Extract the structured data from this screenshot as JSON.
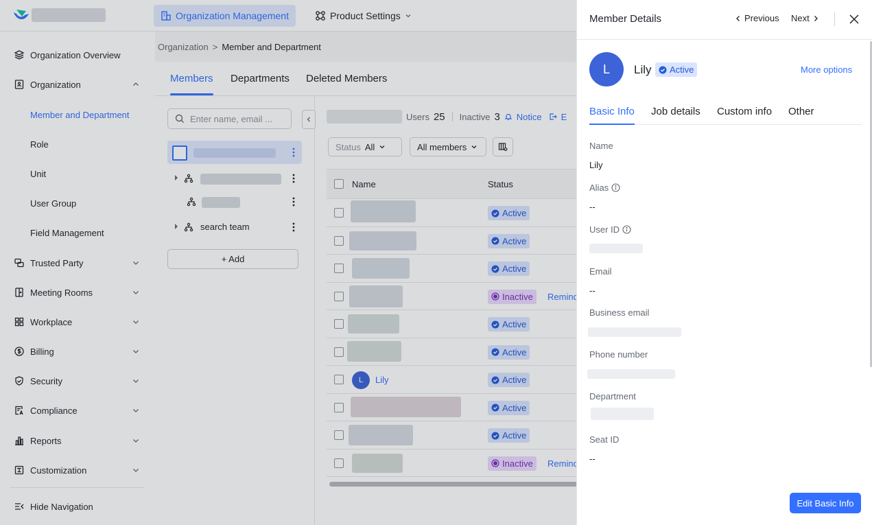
{
  "topbar": {
    "tabs": [
      {
        "label": "Organization Management",
        "icon": "org-chart-icon",
        "active": true
      },
      {
        "label": "Product Settings",
        "icon": "product-settings-icon",
        "active": false
      }
    ]
  },
  "sidebar": {
    "items": [
      {
        "label": "Organization Overview",
        "icon": "layers-icon"
      },
      {
        "label": "Organization",
        "icon": "org-badge-icon",
        "expanded": true
      },
      {
        "label": "Member and Department",
        "selected": true
      },
      {
        "label": "Role"
      },
      {
        "label": "Unit"
      },
      {
        "label": "User Group"
      },
      {
        "label": "Field Management"
      },
      {
        "label": "Trusted Party",
        "icon": "trusted-party-icon"
      },
      {
        "label": "Meeting Rooms",
        "icon": "door-icon"
      },
      {
        "label": "Workplace",
        "icon": "grid-icon"
      },
      {
        "label": "Billing",
        "icon": "dollar-icon"
      },
      {
        "label": "Security",
        "icon": "shield-icon"
      },
      {
        "label": "Compliance",
        "icon": "compliance-icon"
      },
      {
        "label": "Reports",
        "icon": "bar-chart-icon"
      },
      {
        "label": "Customization",
        "icon": "customization-icon"
      }
    ],
    "hide_nav": "Hide Navigation"
  },
  "breadcrumb": {
    "root": "Organization",
    "separator": ">",
    "current": "Member and Department"
  },
  "subtabs": [
    "Members",
    "Departments",
    "Deleted Members"
  ],
  "dept_panel": {
    "search_placeholder": "Enter name, email ...",
    "tree_items": [
      "search team"
    ],
    "add_label": "+ Add"
  },
  "stats": {
    "users_label": "Users",
    "users_count": "25",
    "inactive_label": "Inactive",
    "inactive_count": "3",
    "notice": "Notice",
    "export_partial": "E"
  },
  "filters": {
    "status_label": "Status",
    "status_value": "All",
    "members_value": "All members"
  },
  "table": {
    "headers": {
      "name": "Name",
      "status": "Status"
    },
    "rows": [
      {
        "name": "",
        "status": "Active"
      },
      {
        "name": "",
        "status": "Active"
      },
      {
        "name": "",
        "status": "Active"
      },
      {
        "name": "",
        "status": "Inactive",
        "remind": "Remind"
      },
      {
        "name": "",
        "status": "Active"
      },
      {
        "name": "",
        "status": "Active"
      },
      {
        "name": "Lily",
        "avatar": "L",
        "status": "Active"
      },
      {
        "name": "",
        "status": "Active"
      },
      {
        "name": "",
        "status": "Active"
      },
      {
        "name": "",
        "status": "Inactive",
        "remind": "Remind"
      }
    ]
  },
  "drawer": {
    "title": "Member Details",
    "previous": "Previous",
    "next": "Next",
    "profile": {
      "initial": "L",
      "name": "Lily",
      "status": "Active",
      "more": "More options"
    },
    "tabs": [
      "Basic Info",
      "Job details",
      "Custom info",
      "Other"
    ],
    "fields": [
      {
        "label": "Name",
        "value": "Lily"
      },
      {
        "label": "Alias",
        "value": "--",
        "info": true
      },
      {
        "label": "User ID",
        "value": "",
        "info": true
      },
      {
        "label": "Email",
        "value": "--"
      },
      {
        "label": "Business email",
        "value": ""
      },
      {
        "label": "Phone number",
        "value": ""
      },
      {
        "label": "Department",
        "value": ""
      },
      {
        "label": "Seat ID",
        "value": "--"
      }
    ],
    "edit_button": "Edit Basic Info"
  },
  "colors": {
    "accent": "#3370ff",
    "active_badge_bg": "#d9e4ff",
    "inactive_badge_bg": "#ead9ff",
    "avatar": "#3c63d8"
  }
}
